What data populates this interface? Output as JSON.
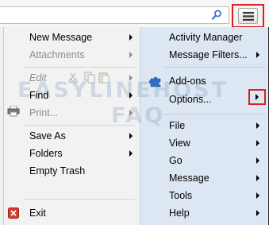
{
  "toolbar": {
    "search_icon": "search-icon",
    "menu_icon": "hamburger-menu-icon"
  },
  "left_menu": {
    "new_message": "New Message",
    "attachments": "Attachments",
    "edit": "Edit",
    "find": "Find",
    "print": "Print...",
    "save_as": "Save As",
    "folders": "Folders",
    "empty_trash": "Empty Trash",
    "exit": "Exit"
  },
  "right_menu": {
    "activity_manager": "Activity Manager",
    "message_filters": "Message Filters...",
    "addons": "Add-ons",
    "options": "Options...",
    "file": "File",
    "view": "View",
    "go": "Go",
    "message": "Message",
    "tools": "Tools",
    "help": "Help"
  },
  "watermark": {
    "line1": "EASYLINEHOST",
    "line2": "FAQ"
  },
  "colors": {
    "highlight_border": "#d9201f",
    "right_pane_bg": "#dde7f3",
    "left_pane_bg": "#f2f2f2",
    "disabled_text": "#8d8d8d"
  }
}
